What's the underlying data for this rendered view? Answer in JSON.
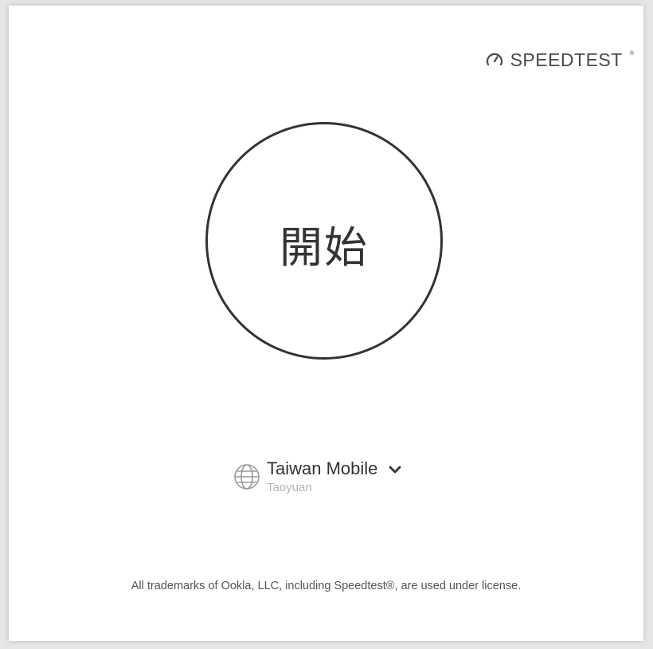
{
  "brand": {
    "name": "SPEEDTEST",
    "tm": "®",
    "icon": "speedometer-icon"
  },
  "start": {
    "label": "開始"
  },
  "server": {
    "provider": "Taiwan Mobile",
    "location": "Taoyuan",
    "icon": "globe-icon",
    "dropdown_icon": "chevron-down-icon"
  },
  "footer": {
    "text": "All trademarks of Ookla, LLC, including Speedtest®, are used under license."
  },
  "colors": {
    "background": "#e6e6e6",
    "card": "#ffffff",
    "primary_text": "#333333",
    "secondary_text": "#b3b3b3"
  }
}
